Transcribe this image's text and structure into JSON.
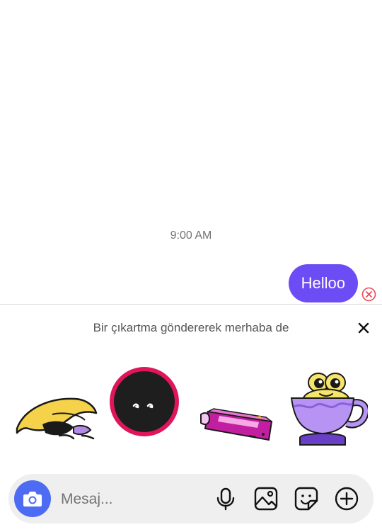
{
  "chat": {
    "timestamp": "9:00 AM",
    "messages": [
      {
        "text": "Helloo",
        "direction": "outgoing",
        "status": "failed"
      }
    ]
  },
  "sticker_panel": {
    "prompt": "Bir çıkartma göndererek merhaba de",
    "stickers": [
      {
        "name": "sleeping-banana-sticker"
      },
      {
        "name": "dark-eyes-circle-sticker"
      },
      {
        "name": "pink-handheld-device-sticker"
      },
      {
        "name": "frog-in-cup-sticker"
      }
    ]
  },
  "composer": {
    "placeholder": "Mesaj...",
    "icons": [
      "camera-icon",
      "microphone-icon",
      "gallery-icon",
      "sticker-icon",
      "add-icon"
    ]
  },
  "colors": {
    "accent": "#6c4cf5",
    "camera": "#4e6bf3",
    "error": "#ed4956"
  }
}
